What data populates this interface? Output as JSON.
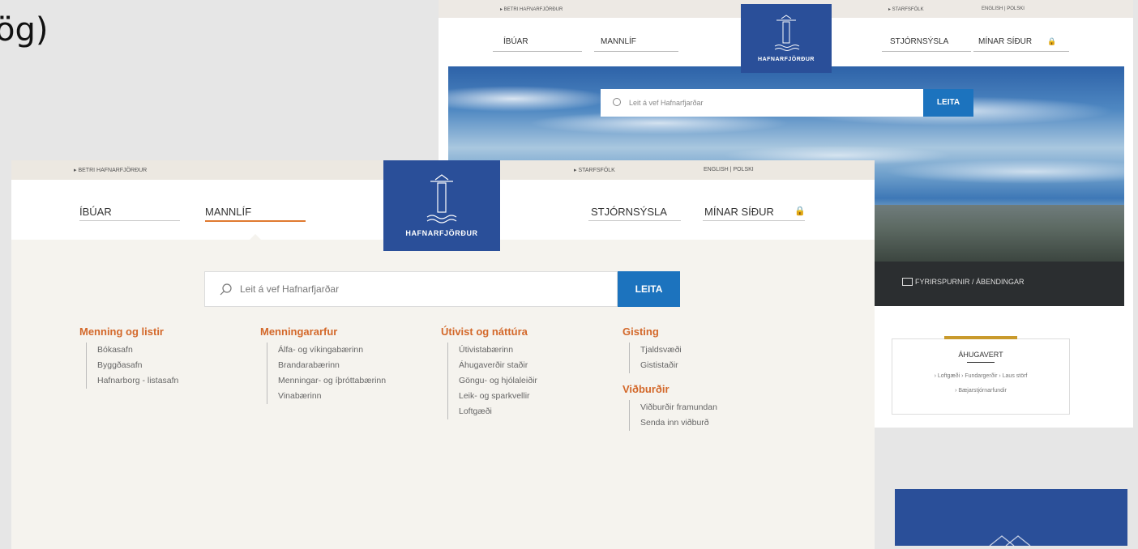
{
  "slide_fragment": "ög)",
  "back": {
    "utility_left": "▸ BETRI HAFNARFJÖRÐUR",
    "utility_staff": "▸ STARFSFÓLK",
    "utility_lang": "ENGLISH | POLSKI",
    "nav": [
      "ÍBÚAR",
      "MANNLÍF",
      "STJÓRNSÝSLA",
      "MÍNAR SÍÐUR"
    ],
    "logo_text": "HAFNARFJÖRÐUR",
    "search_placeholder": "Leit á vef Hafnarfjarðar",
    "search_button": "LEITA",
    "footbar_text": "FYRIRSPURNIR / ÁBENDINGAR",
    "ahugavert": {
      "title": "ÁHUGAVERT",
      "line1": "› Loftgæði  › Fundargerðir  › Laus störf",
      "line2": "› Bæjarstjórnarfundir"
    }
  },
  "front": {
    "utility_left": "▸ BETRI HAFNARFJÖRÐUR",
    "utility_staff": "▸ STARFSFÓLK",
    "utility_lang": "ENGLISH | POLSKI",
    "nav": [
      "ÍBÚAR",
      "MANNLÍF",
      "STJÓRNSÝSLA",
      "MÍNAR SÍÐUR"
    ],
    "logo_text": "HAFNARFJÖRÐUR",
    "search_placeholder": "Leit á vef Hafnarfjarðar",
    "search_button": "LEITA",
    "columns": [
      {
        "title": "Menning og listir",
        "items": [
          "Bókasafn",
          "Byggðasafn",
          "Hafnarborg - listasafn"
        ]
      },
      {
        "title": "Menningararfur",
        "items": [
          "Álfa- og víkingabærinn",
          "Brandarabærinn",
          "Menningar- og íþróttabærinn",
          "Vinabærinn"
        ]
      },
      {
        "title": "Útivist og náttúra",
        "items": [
          "Útivistabærinn",
          "Áhugaverðir staðir",
          "Göngu- og hjólaleiðir",
          "Leik- og sparkvellir",
          "Loftgæði"
        ]
      },
      {
        "title": "Gisting",
        "items": [
          "Tjaldsvæði",
          "Gististaðir"
        ]
      },
      {
        "title": "Viðburðir",
        "items": [
          "Viðburðir framundan",
          "Senda inn viðburð"
        ]
      }
    ]
  },
  "colors": {
    "brand_blue": "#2a4f99",
    "accent_orange": "#e07a30",
    "button_blue": "#1c73be",
    "heading_orange": "#d3682a"
  }
}
